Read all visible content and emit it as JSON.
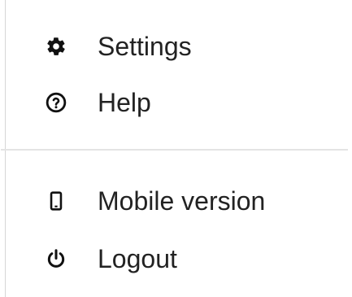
{
  "menu": {
    "items": [
      {
        "label": "Settings",
        "icon": "gear-icon"
      },
      {
        "label": "Help",
        "icon": "question-circle-icon"
      },
      {
        "label": "Mobile version",
        "icon": "mobile-phone-icon"
      },
      {
        "label": "Logout",
        "icon": "power-icon"
      }
    ]
  },
  "colors": {
    "text": "#222222",
    "divider": "#e4e4e4",
    "background": "#ffffff"
  }
}
